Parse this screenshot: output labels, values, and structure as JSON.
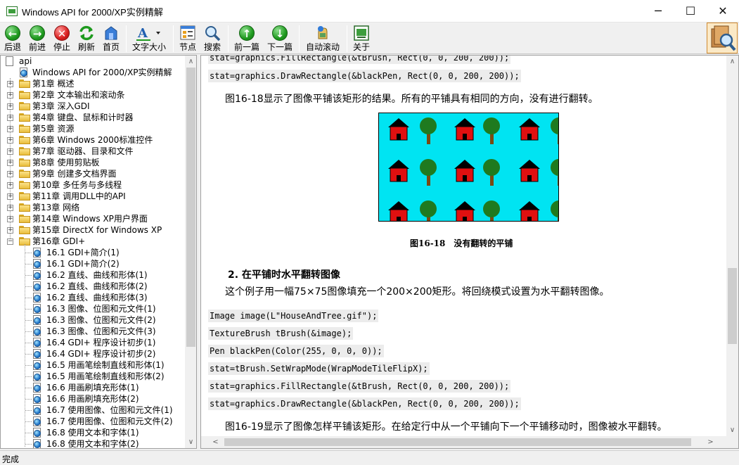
{
  "window": {
    "title": "Windows API for 2000/XP实例精解",
    "minimize_glyph": "─",
    "maximize_glyph": "☐",
    "close_glyph": "✕"
  },
  "toolbar": {
    "back": "后退",
    "forward": "前进",
    "stop": "停止",
    "refresh": "刷新",
    "home": "首页",
    "font_size": "文字大小",
    "nodes": "节点",
    "search": "搜索",
    "prev": "前一篇",
    "next": "下一篇",
    "auto_scroll": "自动滚动",
    "about": "关于"
  },
  "tree": {
    "root": "api",
    "book": "Windows API for 2000/XP实例精解",
    "chapters": [
      "第1章 概述",
      "第2章 文本输出和滚动条",
      "第3章 深入GDI",
      "第4章 键盘、鼠标和计时器",
      "第5章 资源",
      "第6章 Windows 2000标准控件",
      "第7章 驱动器、目录和文件",
      "第8章 使用剪贴板",
      "第9章 创建多文档界面",
      "第10章 多任务与多线程",
      "第11章 调用DLL中的API",
      "第13章 网络",
      "第14章 Windows XP用户界面",
      "第15章 DirectX for Windows XP"
    ],
    "open_chapter": "第16章 GDI+",
    "sections": [
      "16.1 GDI+简介(1)",
      "16.1 GDI+简介(2)",
      "16.2 直线、曲线和形体(1)",
      "16.2 直线、曲线和形体(2)",
      "16.2 直线、曲线和形体(3)",
      "16.3 图像、位图和元文件(1)",
      "16.3 图像、位图和元文件(2)",
      "16.3 图像、位图和元文件(3)",
      "16.4 GDI+ 程序设计初步(1)",
      "16.4 GDI+ 程序设计初步(2)",
      "16.5 用画笔绘制直线和形体(1)",
      "16.5 用画笔绘制直线和形体(2)",
      "16.6 用画刷填充形体(1)",
      "16.6 用画刷填充形体(2)",
      "16.7 使用图像、位图和元文件(1)",
      "16.7 使用图像、位图和元文件(2)",
      "16.8 使用文本和字体(1)",
      "16.8 使用文本和字体(2)"
    ]
  },
  "content": {
    "code_top": [
      "stat=graphics.FillRectangle(&tBrush, Rect(0, 0, 200, 200));",
      "stat=graphics.DrawRectangle(&blackPen, Rect(0, 0, 200, 200));"
    ],
    "para1": "图16-18显示了图像平铺该矩形的结果。所有的平铺具有相同的方向，没有进行翻转。",
    "figure_caption": "图16-18　没有翻转的平铺",
    "section_title": "2. 在平铺时水平翻转图像",
    "para2": "这个例子用一幅75×75图像填充一个200×200矩形。将回绕模式设置为水平翻转图像。",
    "code_bottom": [
      "Image image(L\"HouseAndTree.gif\");",
      "TextureBrush tBrush(&image);",
      "Pen blackPen(Color(255, 0, 0, 0));",
      "stat=tBrush.SetWrapMode(WrapModeTileFlipX);",
      "stat=graphics.FillRectangle(&tBrush, Rect(0, 0, 200, 200));",
      "stat=graphics.DrawRectangle(&blackPen, Rect(0, 0, 200, 200));"
    ],
    "para3": "图16-19显示了图像怎样平铺该矩形。在给定行中从一个平铺向下一个平铺移动时，图像被水平翻转。"
  },
  "status": {
    "text": "完成"
  },
  "colors": {
    "tile_background": "#00e4f2",
    "house_red": "#e01010",
    "tree_green": "#1f7a1f",
    "trunk_brown": "#7a4a12"
  }
}
